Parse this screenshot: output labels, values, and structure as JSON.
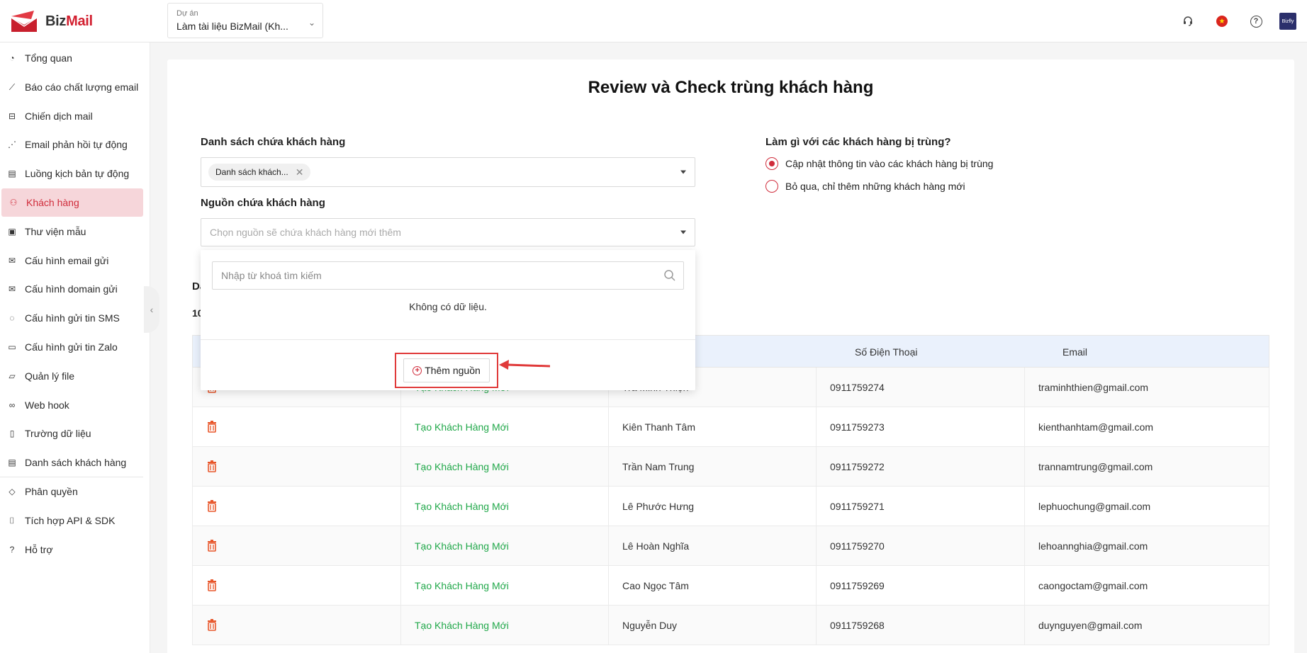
{
  "brand": {
    "name_part1": "Biz",
    "name_part2": "Mail"
  },
  "project": {
    "label": "Dự án",
    "value": "Làm tài liệu BizMail (Kh..."
  },
  "topbar_icons": [
    "headset-icon",
    "vietnam-flag-icon",
    "help-icon",
    "avatar"
  ],
  "avatar_text": "Bizfly",
  "sidebar": {
    "items": [
      {
        "label": "Tổng quan",
        "icon": "pie-chart-icon",
        "symbol": "◔"
      },
      {
        "label": "Báo cáo chất lượng email",
        "icon": "line-chart-icon",
        "symbol": "⟋"
      },
      {
        "label": "Chiến dịch mail",
        "icon": "inbox-icon",
        "symbol": "⊟"
      },
      {
        "label": "Email phản hồi tự động",
        "icon": "share-nodes-icon",
        "symbol": "⋰"
      },
      {
        "label": "Luồng kịch bản tự động",
        "icon": "calendar-flow-icon",
        "symbol": "▤"
      },
      {
        "label": "Khách hàng",
        "icon": "users-icon",
        "symbol": "⚇",
        "active": true
      },
      {
        "label": "Thư viện mẫu",
        "icon": "template-icon",
        "symbol": "▣"
      },
      {
        "label": "Cấu hình email gửi",
        "icon": "email-config-icon",
        "symbol": "✉"
      },
      {
        "label": "Cấu hình domain gửi",
        "icon": "envelope-icon",
        "symbol": "✉"
      },
      {
        "label": "Cấu hình gửi tin SMS",
        "icon": "chat-bubble-icon",
        "symbol": "◌"
      },
      {
        "label": "Cấu hình gửi tin Zalo",
        "icon": "zalo-icon",
        "symbol": "▭"
      },
      {
        "label": "Quản lý file",
        "icon": "folder-icon",
        "symbol": "▱"
      },
      {
        "label": "Web hook",
        "icon": "webhook-icon",
        "symbol": "∞"
      },
      {
        "label": "Trường dữ liệu",
        "icon": "document-icon",
        "symbol": "▯"
      },
      {
        "label": "Danh sách khách hàng",
        "icon": "list-icon",
        "symbol": "▤"
      },
      {
        "label": "Phân quyền",
        "icon": "shield-icon",
        "symbol": "◇"
      },
      {
        "label": "Tích hợp API & SDK",
        "icon": "code-icon",
        "symbol": "⌷"
      },
      {
        "label": "Hỗ trợ",
        "icon": "support-icon",
        "symbol": "?"
      }
    ]
  },
  "page": {
    "title": "Review và Check trùng khách hàng",
    "customer_list_label": "Danh sách chứa khách hàng",
    "customer_list_tag": "Danh sách khách...",
    "source_label": "Nguồn chứa khách hàng",
    "source_placeholder": "Chọn nguồn sẽ chứa khách hàng mới thêm",
    "duplicate_question": "Làm gì với các khách hàng bị trùng?",
    "duplicate_options": [
      {
        "label": "Cập nhật thông tin vào các khách hàng bị trùng",
        "checked": true
      },
      {
        "label": "Bỏ qua, chỉ thêm những khách hàng mới",
        "checked": false
      }
    ],
    "partial_label_1": "Da",
    "partial_label_2": "10"
  },
  "dropdown": {
    "search_placeholder": "Nhập từ khoá tìm kiếm",
    "empty_text": "Không có dữ liệu.",
    "add_source_label": "Thêm nguồn"
  },
  "table": {
    "headers": [
      "",
      "",
      "",
      "Số Điện Thoại",
      "Email"
    ],
    "rows": [
      {
        "status": "Tạo Khách Hàng Mới",
        "name": "Trà Minh Thiện",
        "phone": "0911759274",
        "email": "traminhthien@gmail.com"
      },
      {
        "status": "Tạo Khách Hàng Mới",
        "name": "Kiên Thanh Tâm",
        "phone": "0911759273",
        "email": "kienthanhtam@gmail.com"
      },
      {
        "status": "Tạo Khách Hàng Mới",
        "name": "Trần Nam Trung",
        "phone": "0911759272",
        "email": "trannamtrung@gmail.com"
      },
      {
        "status": "Tạo Khách Hàng Mới",
        "name": "Lê Phước Hưng",
        "phone": "0911759271",
        "email": "lephuochung@gmail.com"
      },
      {
        "status": "Tạo Khách Hàng Mới",
        "name": "Lê Hoàn Nghĩa",
        "phone": "0911759270",
        "email": "lehoannghia@gmail.com"
      },
      {
        "status": "Tạo Khách Hàng Mới",
        "name": "Cao Ngọc Tâm",
        "phone": "0911759269",
        "email": "caongoctam@gmail.com"
      },
      {
        "status": "Tạo Khách Hàng Mới",
        "name": "Nguyễn Duy",
        "phone": "0911759268",
        "email": "duynguyen@gmail.com"
      }
    ]
  },
  "colors": {
    "accent": "#d02c3b",
    "active_bg": "#f6d6da",
    "status_green": "#21a84a",
    "table_header": "#eaf1fc",
    "highlight_box": "#e03a3a"
  }
}
